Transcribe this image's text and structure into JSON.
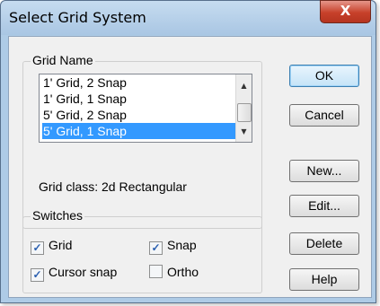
{
  "window": {
    "title": "Select Grid System",
    "close_label": "X"
  },
  "grid_name_group": {
    "label": "Grid Name",
    "items": [
      "1' Grid, 2 Snap",
      "1' Grid, 1 Snap",
      "5' Grid, 2 Snap",
      "5' Grid, 1 Snap"
    ],
    "selected_index": 3
  },
  "grid_class": "Grid class:  2d Rectangular",
  "switches": {
    "label": "Switches",
    "grid": {
      "label": "Grid",
      "checked": true
    },
    "snap": {
      "label": "Snap",
      "checked": true
    },
    "cursor_snap": {
      "label": "Cursor snap",
      "checked": true
    },
    "ortho": {
      "label": "Ortho",
      "checked": false
    }
  },
  "buttons": {
    "ok": "OK",
    "cancel": "Cancel",
    "new": "New...",
    "edit": "Edit...",
    "delete": "Delete",
    "help": "Help"
  },
  "colors": {
    "selection": "#3399ff",
    "title_bar": "#aecbe6",
    "close": "#c7402a"
  }
}
